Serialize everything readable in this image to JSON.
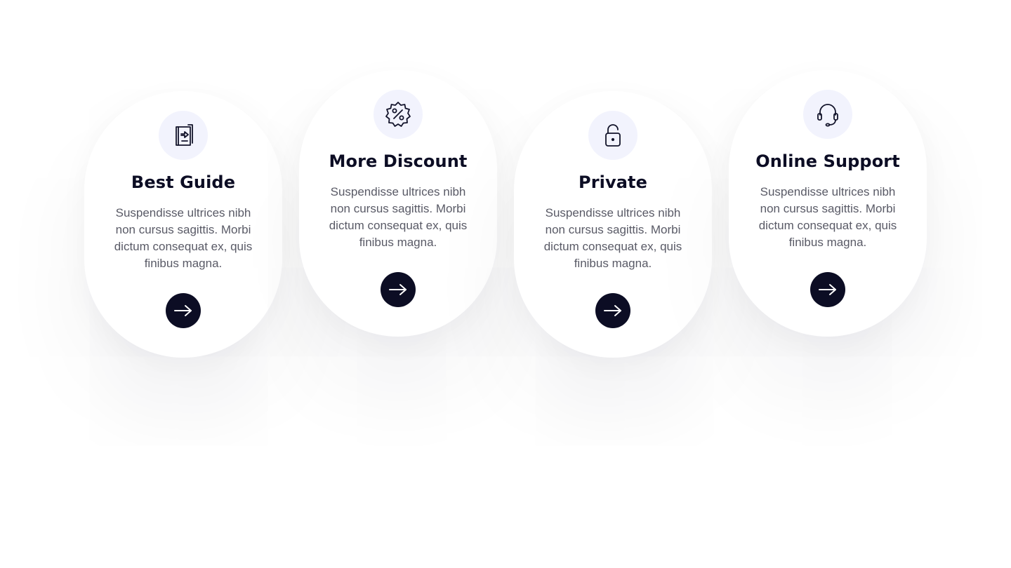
{
  "features": [
    {
      "title": "Best Guide",
      "text": "Suspendisse ultrices nibh non cursus sagittis. Morbi dictum consequat ex, quis finibus magna.",
      "icon": "guide-book-icon",
      "action_icon": "arrow-right-icon"
    },
    {
      "title": "More Discount",
      "text": "Suspendisse ultrices nibh non cursus sagittis. Morbi dictum consequat ex, quis finibus magna.",
      "icon": "discount-badge-icon",
      "action_icon": "arrow-right-icon"
    },
    {
      "title": "Private",
      "text": "Suspendisse ultrices nibh non cursus sagittis. Morbi dictum consequat ex, quis finibus magna.",
      "icon": "unlocked-padlock-icon",
      "action_icon": "arrow-right-icon"
    },
    {
      "title": "Online Support",
      "text": "Suspendisse ultrices nibh non cursus sagittis. Morbi dictum consequat ex, quis finibus magna.",
      "icon": "headset-icon",
      "action_icon": "arrow-right-icon"
    }
  ],
  "colors": {
    "background": "#ffffff",
    "card": "#ffffff",
    "icon_circle": "#f2f3fd",
    "heading": "#0c0d24",
    "body_text": "#595a66",
    "button": "#0c0d24",
    "button_icon": "#ffffff"
  }
}
